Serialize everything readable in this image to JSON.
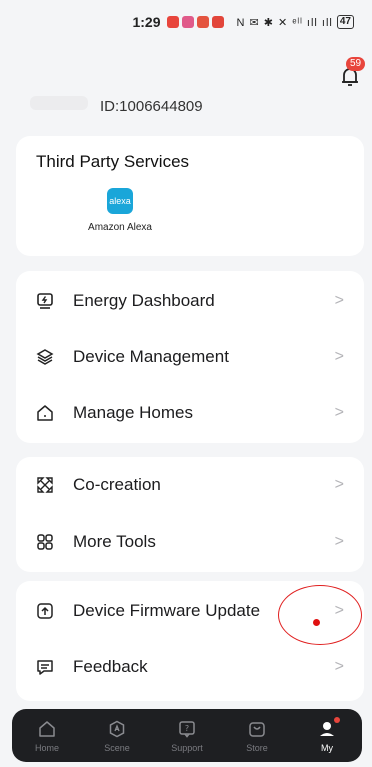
{
  "status_bar": {
    "time": "1:29",
    "indicators": "N ✉ ✱ ✕ ᵉˡˡ ıll ıll",
    "battery": "47"
  },
  "header": {
    "notification_count": "59",
    "user_id": "ID:1006644809"
  },
  "third_party": {
    "title": "Third Party Services",
    "services": [
      {
        "logo_text": "alexa",
        "label": "Amazon Alexa"
      }
    ]
  },
  "main_menu": [
    {
      "label": "Energy Dashboard",
      "icon": "energy-icon",
      "chevron": ">"
    },
    {
      "label": "Device Management",
      "icon": "layers-icon",
      "chevron": ">"
    },
    {
      "label": "Manage Homes",
      "icon": "home-icon",
      "chevron": ">"
    }
  ],
  "tools_menu": [
    {
      "label": "Co-creation",
      "icon": "co-creation-icon",
      "chevron": ">"
    },
    {
      "label": "More Tools",
      "icon": "grid-icon",
      "chevron": ">"
    }
  ],
  "support_menu": [
    {
      "label": "Device Firmware Update",
      "icon": "upload-icon",
      "chevron": ">"
    },
    {
      "label": "Feedback",
      "icon": "message-icon",
      "chevron": ">"
    }
  ],
  "tabbar": {
    "tabs": [
      {
        "label": "Home",
        "icon": "home-tab-icon"
      },
      {
        "label": "Scene",
        "icon": "scene-tab-icon"
      },
      {
        "label": "Support",
        "icon": "support-tab-icon"
      },
      {
        "label": "Store",
        "icon": "store-tab-icon"
      },
      {
        "label": "My",
        "icon": "profile-tab-icon"
      }
    ],
    "active": "My"
  },
  "colors": {
    "background": "#f4f5f7",
    "badge": "#e8453c",
    "alexa": "#1aa6d9",
    "tabbar": "#1e1f22"
  }
}
